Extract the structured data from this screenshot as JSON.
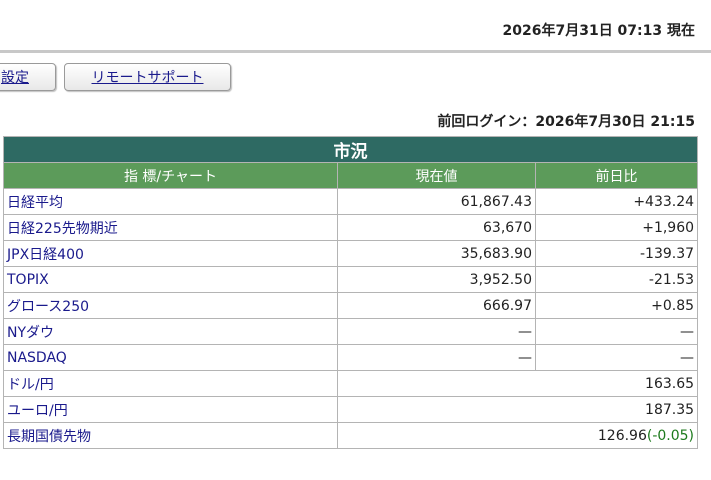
{
  "header": {
    "timestamp": "2026年7月31日 07:13 現在"
  },
  "toolbar": {
    "settings_label": "設定",
    "remote_support_label": "リモートサポート"
  },
  "last_login": "前回ログイン：2026年7月30日 21:15",
  "market": {
    "title": "市況",
    "columns": [
      "指 標/チャート",
      "現在値",
      "前日比"
    ],
    "rows": [
      {
        "name": "日経平均",
        "value": "61,867.43",
        "change": "+433.24"
      },
      {
        "name": "日経225先物期近",
        "value": "63,670",
        "change": "+1,960"
      },
      {
        "name": "JPX日経400",
        "value": "35,683.90",
        "change": "-139.37"
      },
      {
        "name": "TOPIX",
        "value": "3,952.50",
        "change": "-21.53"
      },
      {
        "name": "グロース250",
        "value": "666.97",
        "change": "+0.85"
      },
      {
        "name": "NYダウ",
        "value": "—",
        "change": "—"
      },
      {
        "name": "NASDAQ",
        "value": "—",
        "change": "—"
      }
    ],
    "fx": [
      {
        "name": "ドル/円",
        "value": "163.65"
      },
      {
        "name": "ユーロ/円",
        "value": "187.35"
      }
    ],
    "bond": {
      "name": "長期国債先物",
      "value": "126.96",
      "change": "(-0.05)"
    }
  },
  "colors": {
    "title_bg": "#2e6a63",
    "header_bg": "#5c9b5a",
    "link": "#1a1a8c",
    "positive": "#c81414",
    "negative": "#1c7a1c"
  }
}
